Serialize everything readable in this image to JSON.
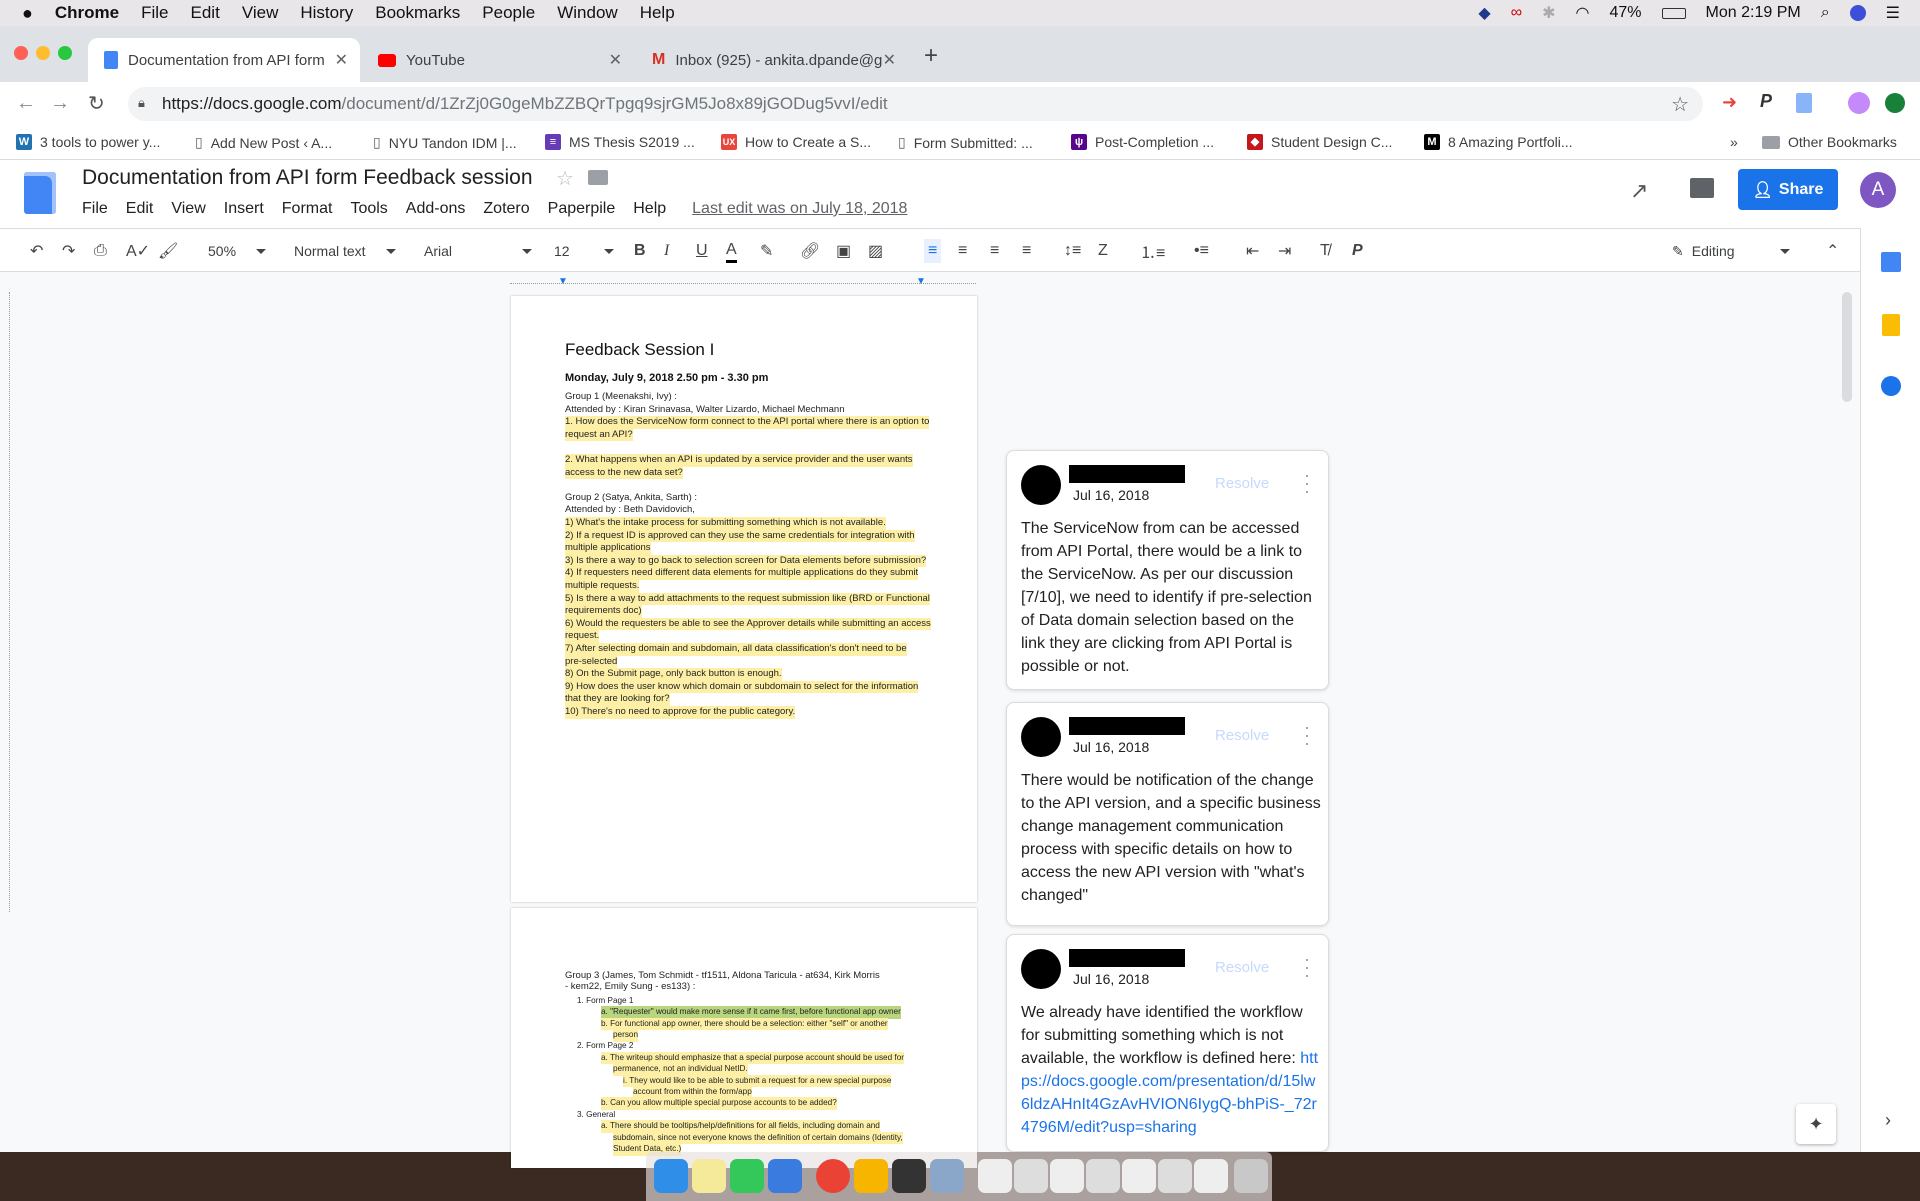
{
  "mac_menubar": {
    "app": "Chrome",
    "items": [
      "File",
      "Edit",
      "View",
      "History",
      "Bookmarks",
      "People",
      "Window",
      "Help"
    ],
    "battery": "47%",
    "clock": "Mon 2:19 PM"
  },
  "tabs": [
    {
      "title": "Documentation from API form F"
    },
    {
      "title": "YouTube"
    },
    {
      "title": "Inbox (925) - ankita.dpande@g"
    }
  ],
  "address": {
    "host": "https://docs.google.com",
    "path": "/document/d/1ZrZj0G0geMbZZBQrTpgq9sjrGM5Jo8x89jGODug5vvI/edit"
  },
  "bookmarks": [
    "3 tools to power y...",
    "Add New Post ‹ A...",
    "NYU Tandon IDM |...",
    "MS Thesis S2019 ...",
    "How to Create a S...",
    "Form Submitted: ...",
    "Post-Completion ...",
    "Student Design C...",
    "8 Amazing Portfoli..."
  ],
  "bookmarks_more": "»",
  "other_bookmarks": "Other Bookmarks",
  "doc": {
    "title": "Documentation from API form Feedback session",
    "menu": [
      "File",
      "Edit",
      "View",
      "Insert",
      "Format",
      "Tools",
      "Add-ons",
      "Zotero",
      "Paperpile",
      "Help"
    ],
    "last_edit": "Last edit was on July 18, 2018",
    "share": "Share",
    "avatar_letter": "A"
  },
  "toolbar": {
    "zoom": "50%",
    "style": "Normal text",
    "font": "Arial",
    "size": "12",
    "mode": "Editing"
  },
  "page1": {
    "title": "Feedback Session I",
    "date": "Monday, July 9, 2018 2.50 pm - 3.30 pm",
    "lines": [
      {
        "t": "Group 1 (Meenakshi, Ivy) :",
        "h": ""
      },
      {
        "t": "Attended by : Kiran Srinavasa, Walter Lizardo, Michael Mechmann",
        "h": ""
      },
      {
        "t": "1. How does the ServiceNow form connect to the API portal where there is an option to",
        "h": "y"
      },
      {
        "t": "request an API?",
        "h": "y"
      },
      {
        "t": "",
        "h": ""
      },
      {
        "t": "2. What happens when an API is updated by a service provider and the user wants",
        "h": "y"
      },
      {
        "t": "access to the new data set?",
        "h": "y"
      },
      {
        "t": "",
        "h": ""
      },
      {
        "t": "Group 2 (Satya, Ankita, Sarth) :",
        "h": ""
      },
      {
        "t": "Attended by : Beth Davidovich,",
        "h": ""
      },
      {
        "t": "1) What's the intake process for submitting something which is not available.",
        "h": "y"
      },
      {
        "t": "2) If a request ID is approved can they use the same credentials for integration with",
        "h": "y"
      },
      {
        "t": "multiple applications",
        "h": "y"
      },
      {
        "t": "3) Is there a way to go back to selection screen for Data elements before submission?",
        "h": "y"
      },
      {
        "t": "4) If requesters need different data elements for multiple applications do they submit",
        "h": "y"
      },
      {
        "t": "multiple requests.",
        "h": "y"
      },
      {
        "t": "5) Is there a way to add attachments to the request submission like (BRD or Functional",
        "h": "y"
      },
      {
        "t": "requirements doc)",
        "h": "y"
      },
      {
        "t": "6) Would the requesters be able to see the Approver details while submitting an access",
        "h": "y"
      },
      {
        "t": "request.",
        "h": "y"
      },
      {
        "t": "7) After selecting domain and subdomain, all data classification's don't need to be",
        "h": "y"
      },
      {
        "t": "pre-selected",
        "h": "y"
      },
      {
        "t": "8) On the Submit page, only back button is enough.",
        "h": "y"
      },
      {
        "t": "9) How does the user know which domain or subdomain to select for the information",
        "h": "y"
      },
      {
        "t": "that they are looking for?",
        "h": "y"
      },
      {
        "t": "10) There's no need to approve for the public category.",
        "h": "y"
      }
    ]
  },
  "page2": {
    "lines": [
      {
        "t": "Group 3 (James, Tom Schmidt - tf1511, Aldona Taricula - at634, Kirk Morris",
        "h": "",
        "i": 0
      },
      {
        "t": "- kem22, Emily Sung - es133) :",
        "h": "",
        "i": 0
      },
      {
        "t": "1.    Form Page 1",
        "h": "",
        "i": 1
      },
      {
        "t": "a.    \"Requester\" would make more sense if it came first, before functional app owner",
        "h": "g",
        "i": 2
      },
      {
        "t": "b.    For functional app owner, there should be a selection: either \"self\" or another",
        "h": "y",
        "i": 2
      },
      {
        "t": "person",
        "h": "y",
        "i": 3
      },
      {
        "t": "2.    Form Page 2",
        "h": "",
        "i": 1
      },
      {
        "t": "a.    The writeup should emphasize that a special purpose account should be used for",
        "h": "y",
        "i": 2
      },
      {
        "t": "permanence, not an individual NetID.",
        "h": "y",
        "i": 3
      },
      {
        "t": "i.    They would like to be able to submit a request for a new special purpose",
        "h": "y",
        "i": 4
      },
      {
        "t": "account from within the form/app",
        "h": "y",
        "i": 5
      },
      {
        "t": "b.    Can you allow multiple special purpose accounts to be added?",
        "h": "y",
        "i": 2
      },
      {
        "t": "3.    General",
        "h": "",
        "i": 1
      },
      {
        "t": "a.    There should be tooltips/help/definitions for all fields, including domain and",
        "h": "y",
        "i": 2
      },
      {
        "t": "subdomain, since not everyone knows the definition of certain domains (Identity,",
        "h": "y",
        "i": 3
      },
      {
        "t": "Student Data, etc.)",
        "h": "y",
        "i": 3
      }
    ]
  },
  "comments": [
    {
      "date": "Jul 16, 2018",
      "resolve": "Resolve",
      "body": "The ServiceNow from can be accessed from API Portal, there would be a link to the ServiceNow. As per our discussion [7/10], we need to identify if pre-selection of Data domain selection based on the link they are clicking from API Portal is possible or not.",
      "link": ""
    },
    {
      "date": "Jul 16, 2018",
      "resolve": "Resolve",
      "body": "There would be notification of the change to the API version, and a specific business change management communication process with specific details on how to access the new API version with \"what's changed\"",
      "link": ""
    },
    {
      "date": "Jul 16, 2018",
      "resolve": "Resolve",
      "body": "We already have identified the workflow for submitting something which is not available, the workflow is defined here:",
      "link": "https://docs.google.com/presentation/d/15lw6ldzAHnIt4GzAvHVION6IygQ-bhPiS-_72r4796M/edit?usp=sharing"
    }
  ]
}
